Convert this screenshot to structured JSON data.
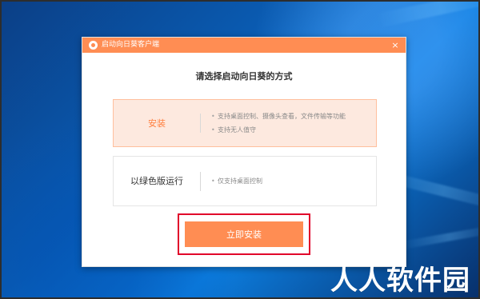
{
  "window": {
    "title": "启动向日葵客户端",
    "close_label": "×"
  },
  "dialog": {
    "headline": "请选择启动向日葵的方式",
    "options": [
      {
        "label": "安装",
        "features": [
          "支持桌面控制、摄像头查看，文件传输等功能",
          "支持无人值守"
        ]
      },
      {
        "label": "以绿色版运行",
        "features": [
          "仅支持桌面控制"
        ]
      }
    ],
    "primary_button_label": "立即安装"
  },
  "watermark": {
    "text": "人人软件园"
  },
  "colors": {
    "accent": "#ff8d53",
    "highlight": "#e1002a"
  },
  "icons": {
    "app_logo": "sunlogin-icon",
    "close": "close-icon",
    "bullet": "bullet-icon"
  }
}
